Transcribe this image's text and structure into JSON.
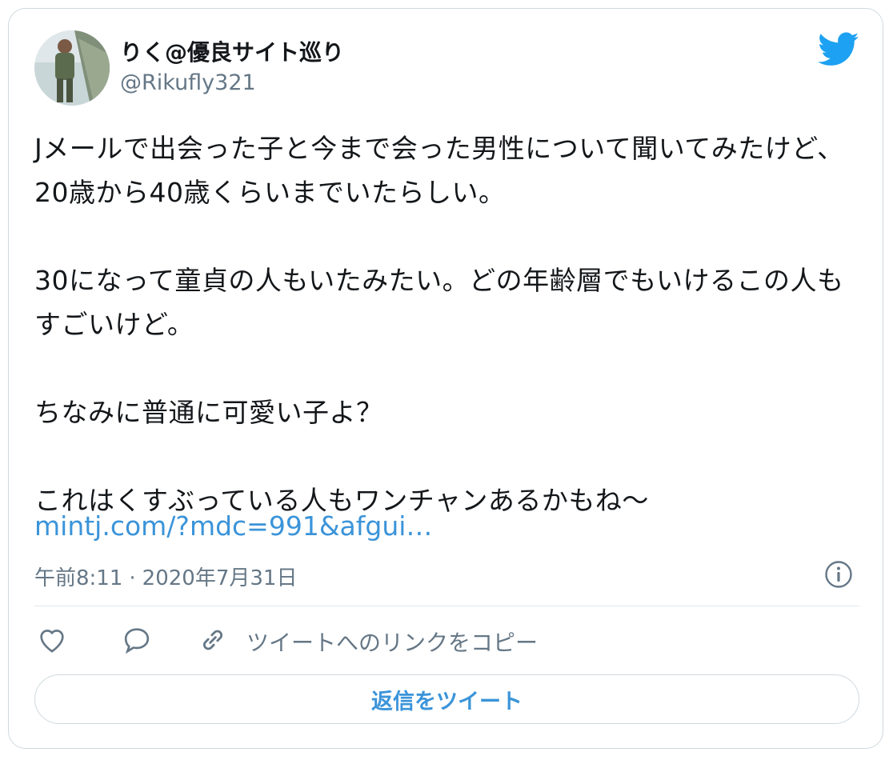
{
  "tweet": {
    "display_name": "りく@優良サイト巡り",
    "handle": "@Rikufly321",
    "text": "Jメールで出会った子と今まで会った男性について聞いてみたけど、20歳から40歳くらいまでいたらしい。\n\n30になって童貞の人もいたみたい。どの年齢層でもいけるこの人もすごいけど。\n\nちなみに普通に可愛い子よ？\n\nこれはくすぶっている人もワンチャンあるかもね〜",
    "link": "mintj.com/?mdc=991&afgui…",
    "time": "午前8:11",
    "separator": "·",
    "date": "2020年7月31日"
  },
  "actions": {
    "copy_link_label": "ツイートへのリンクをコピー",
    "reply_button_label": "返信をツイート"
  },
  "icons": {
    "brand": "twitter-bird-icon",
    "info": "info-icon",
    "like": "heart-icon",
    "reply": "speech-bubble-icon",
    "copy": "link-icon"
  },
  "colors": {
    "brand_blue": "#1da1f2",
    "link_blue": "#3b94d9",
    "secondary_text": "#657786",
    "border": "#cfd9de"
  }
}
